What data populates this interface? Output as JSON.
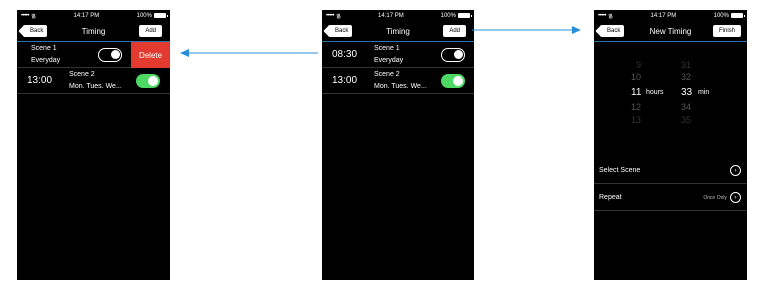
{
  "status_bar": {
    "signal": "•••••",
    "time": "14:17 PM",
    "battery": "100%"
  },
  "colors": {
    "accent_line": "#2a6fb0",
    "toggle_on": "#4cd964",
    "delete": "#e23a2f",
    "arrow": "#2a8fd8"
  },
  "screen1": {
    "back_label": "Back",
    "title": "Timing",
    "add_label": "Add",
    "rows": [
      {
        "time": "",
        "scene": "Scene 1",
        "repeat": "Everyday",
        "enabled": false
      },
      {
        "time": "13:00",
        "scene": "Scene 2",
        "repeat": "Mon. Tues. We...",
        "enabled": true
      }
    ],
    "delete_label": "Delete"
  },
  "screen2": {
    "back_label": "Back",
    "title": "Timing",
    "add_label": "Add",
    "rows": [
      {
        "time": "08:30",
        "scene": "Scene 1",
        "repeat": "Everyday",
        "enabled": false
      },
      {
        "time": "13:00",
        "scene": "Scene 2",
        "repeat": "Mon. Tues. We...",
        "enabled": true
      }
    ]
  },
  "screen3": {
    "back_label": "Back",
    "title": "New Timing",
    "finish_label": "Finish",
    "picker": {
      "hours": [
        "9",
        "10",
        "11",
        "12",
        "13"
      ],
      "minutes": [
        "31",
        "32",
        "33",
        "34",
        "35"
      ],
      "hours_unit": "hours",
      "minutes_unit": "min"
    },
    "select_scene_label": "Select Scene",
    "repeat_label": "Repeat",
    "repeat_value": "Once Only"
  }
}
